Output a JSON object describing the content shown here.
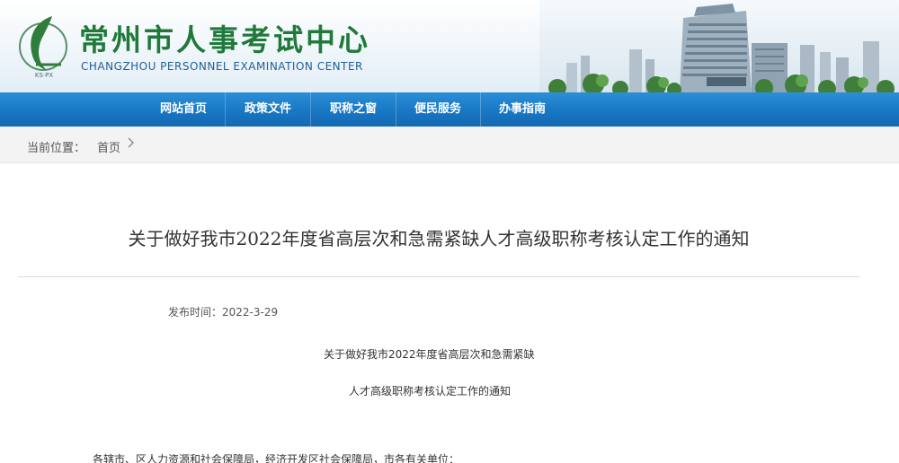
{
  "header": {
    "title": "常州市人事考试中心",
    "subtitle": "CHANGZHOU PERSONNEL EXAMINATION CENTER",
    "logo_caption": "KS·PX",
    "brand_color": "#1f7a3a",
    "sub_color": "#1f5f9a"
  },
  "nav": {
    "items": [
      {
        "label": "网站首页"
      },
      {
        "label": "政策文件"
      },
      {
        "label": "职称之窗"
      },
      {
        "label": "便民服务"
      },
      {
        "label": "办事指南"
      }
    ],
    "color": "#1877c4"
  },
  "breadcrumb": {
    "label": "当前位置：",
    "home": "首页",
    "chevron-icon": "chevron-right-icon"
  },
  "article": {
    "title": "关于做好我市2022年度省高层次和急需紧缺人才高级职称考核认定工作的通知",
    "publish_time": "发布时间：2022-3-29",
    "heading_line1": "关于做好我市2022年度省高层次和急需紧缺",
    "heading_line2": "人才高级职称考核认定工作的通知",
    "salutation": "各辖市、区人力资源和社会保障局，经济开发区社会保障局，市各有关单位："
  }
}
